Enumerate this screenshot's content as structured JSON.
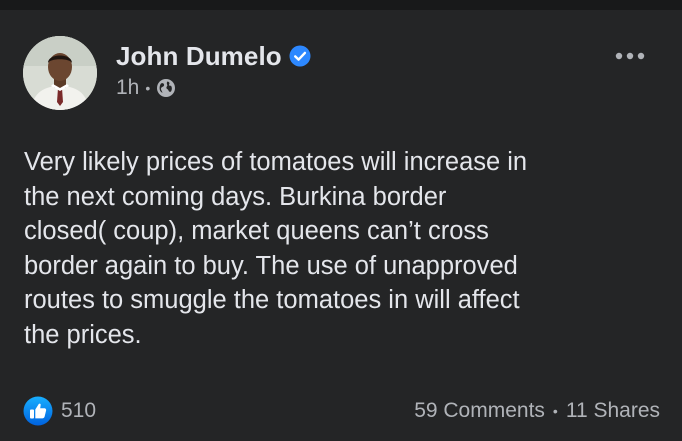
{
  "post": {
    "author": "John Dumelo",
    "verified": true,
    "time": "1h",
    "audience_icon": "globe-icon",
    "more_icon": "more-options-icon",
    "text": "Very likely prices of tomatoes will increase in\nthe next coming days. Burkina border\nclosed( coup), market queens can’t cross\nborder again to buy. The use of unapproved\nroutes to smuggle the tomatoes in will affect\nthe prices."
  },
  "stats": {
    "reaction_icon": "like-icon",
    "likes": "510",
    "comments": "59 Comments",
    "shares": "11 Shares"
  },
  "colors": {
    "background": "#18191a",
    "card": "#242526",
    "primary_text": "#e4e6eb",
    "secondary_text": "#b0b3b8",
    "accent_blue": "#2d88ff"
  }
}
